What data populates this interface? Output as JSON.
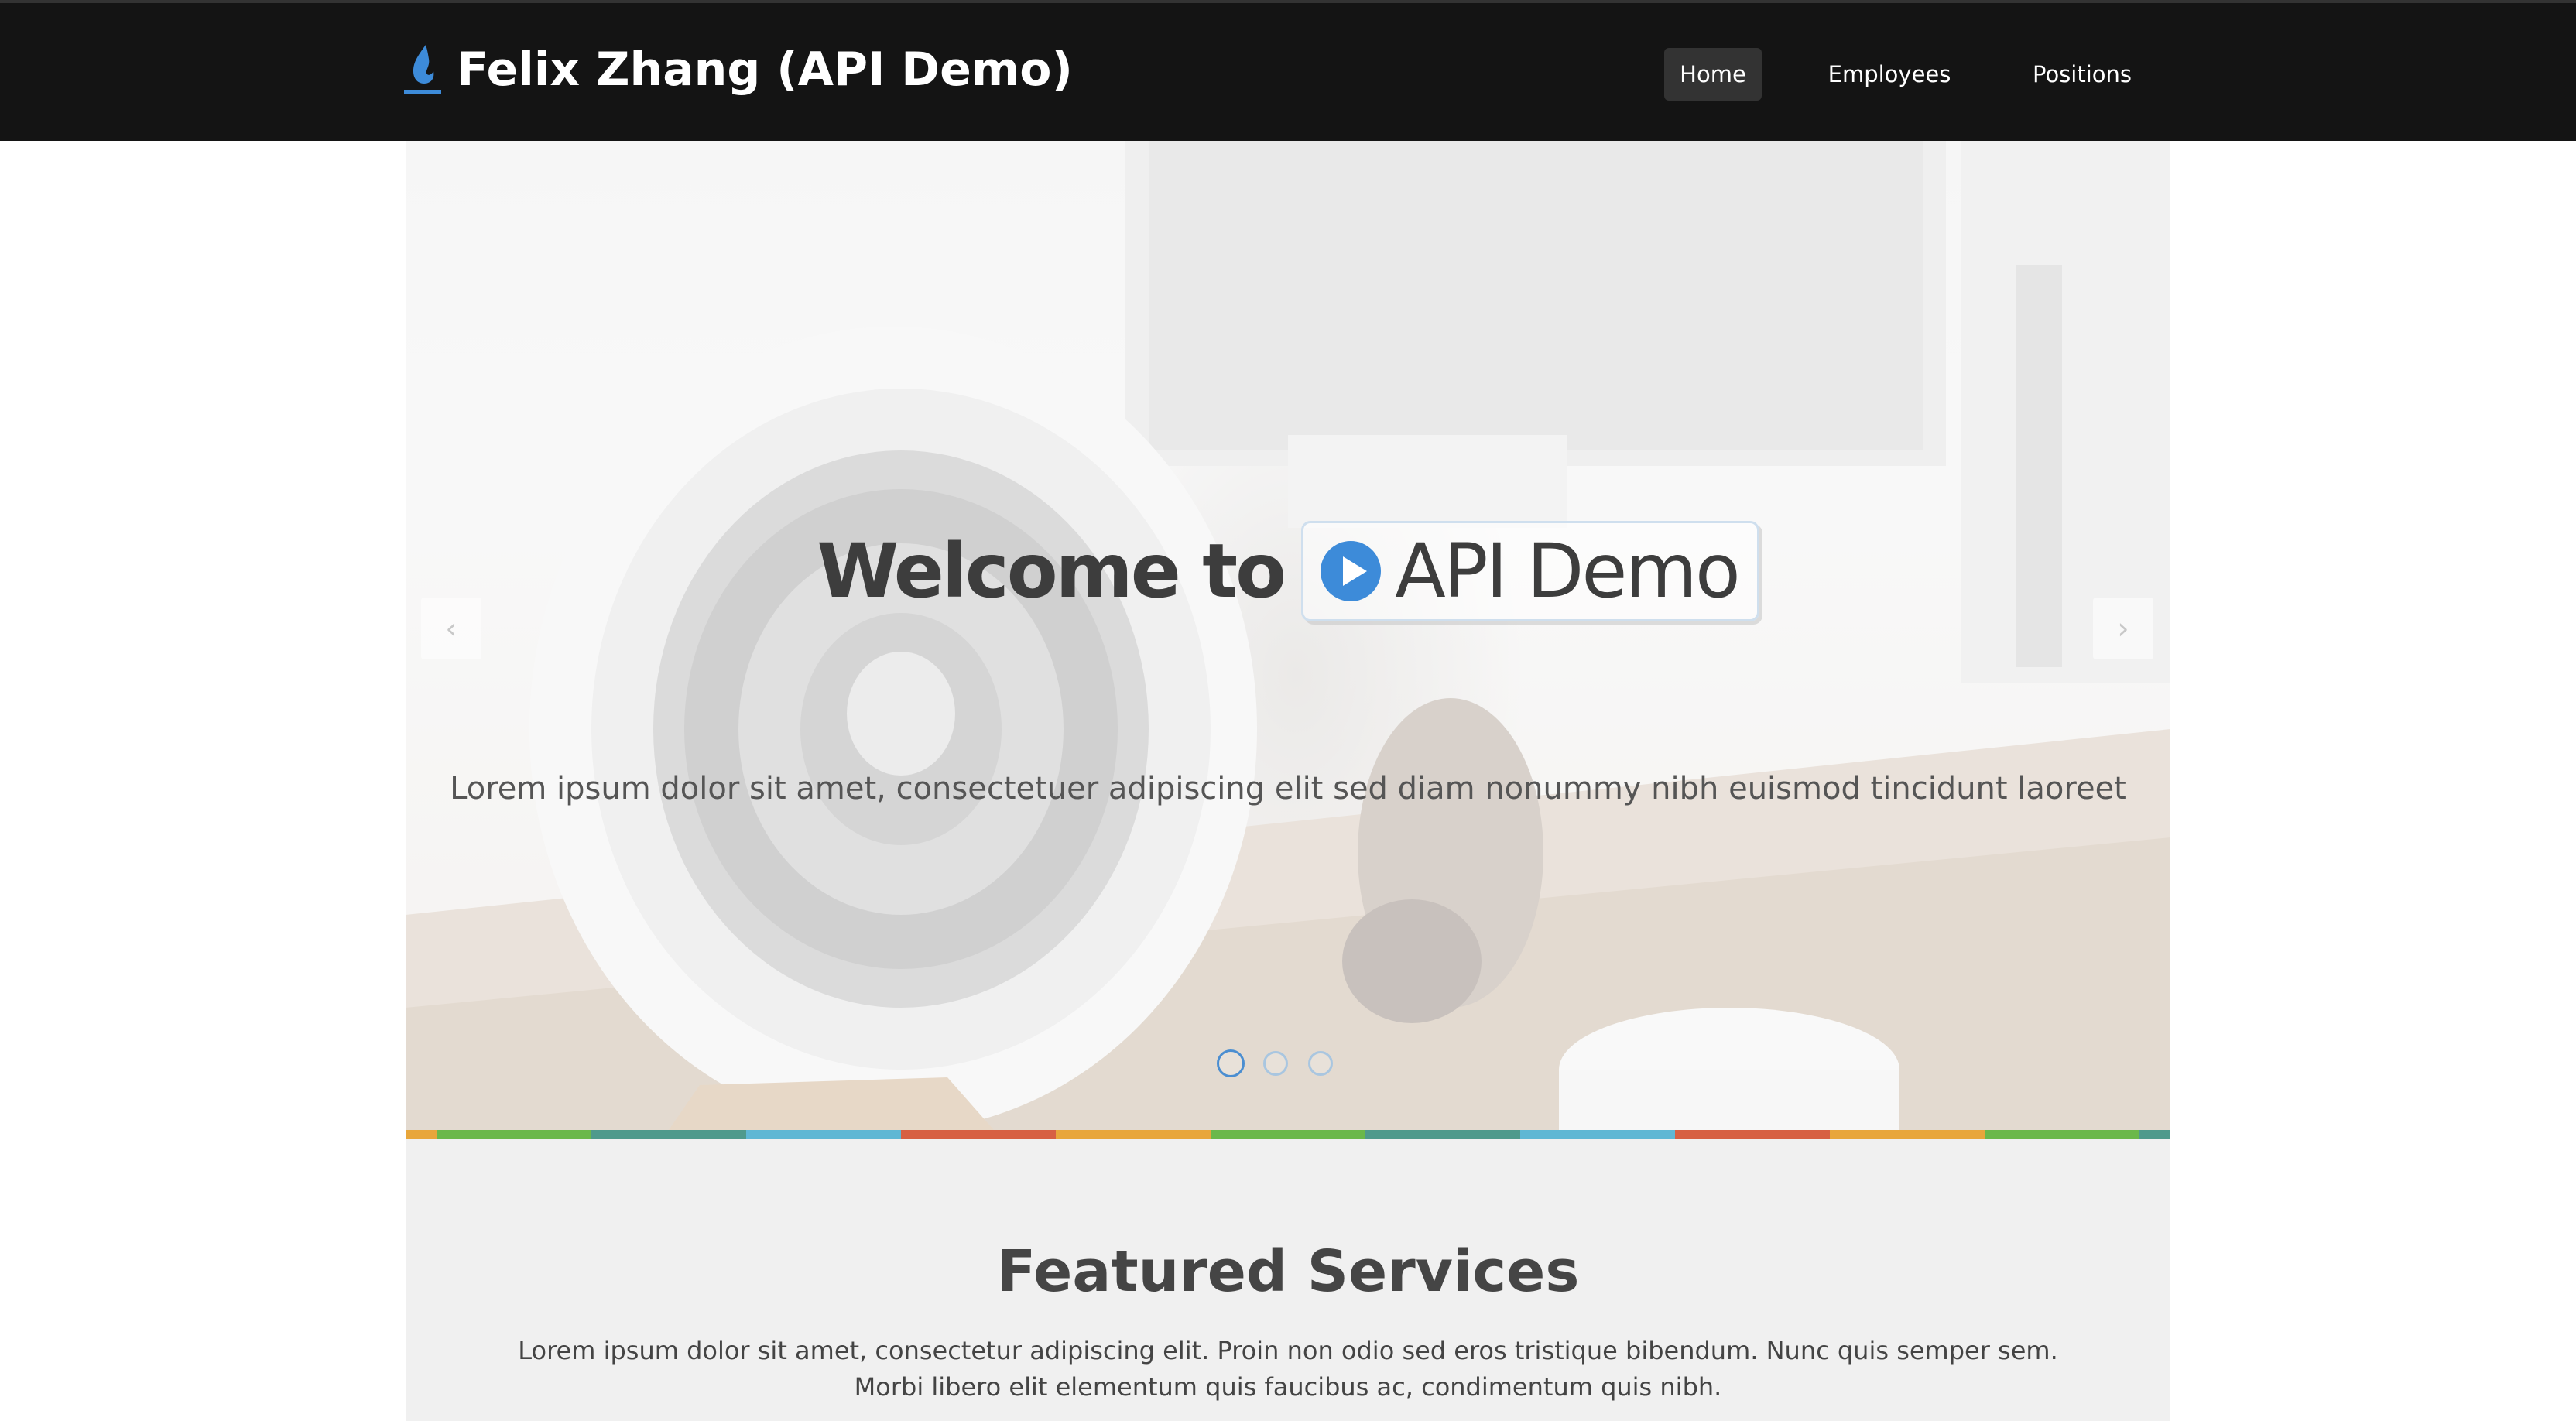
{
  "navbar": {
    "brand_title": "Felix Zhang (API Demo)",
    "brand_icon": "flame-icon",
    "items": [
      {
        "label": "Home",
        "active": true
      },
      {
        "label": "Employees",
        "active": false
      },
      {
        "label": "Positions",
        "active": false
      }
    ]
  },
  "hero": {
    "headline_prefix": "Welcome to",
    "headline_badge": "API Demo",
    "badge_icon": "play-circle-icon",
    "subtitle": "Lorem ipsum dolor sit amet, consectetuer adipiscing elit sed diam nonummy nibh euismod tincidunt laoreet",
    "prev_icon": "chevron-left-icon",
    "next_icon": "chevron-right-icon",
    "prev_glyph": "‹",
    "next_glyph": "›",
    "slide_count": 3,
    "active_slide": 1
  },
  "featured": {
    "title": "Featured Services",
    "text_line1": "Lorem ipsum dolor sit amet, consectetur adipiscing elit. Proin non odio sed eros tristique bibendum. Nunc quis semper sem.",
    "text_line2": "Morbi libero elit elementum quis faucibus ac, condimentum quis nibh."
  },
  "colors": {
    "navbar_bg": "#141414",
    "accent_blue": "#4b8ed1",
    "strip": [
      "#e8a63b",
      "#6bb84a",
      "#4f9a8c",
      "#5fb7d4",
      "#d76043"
    ]
  }
}
